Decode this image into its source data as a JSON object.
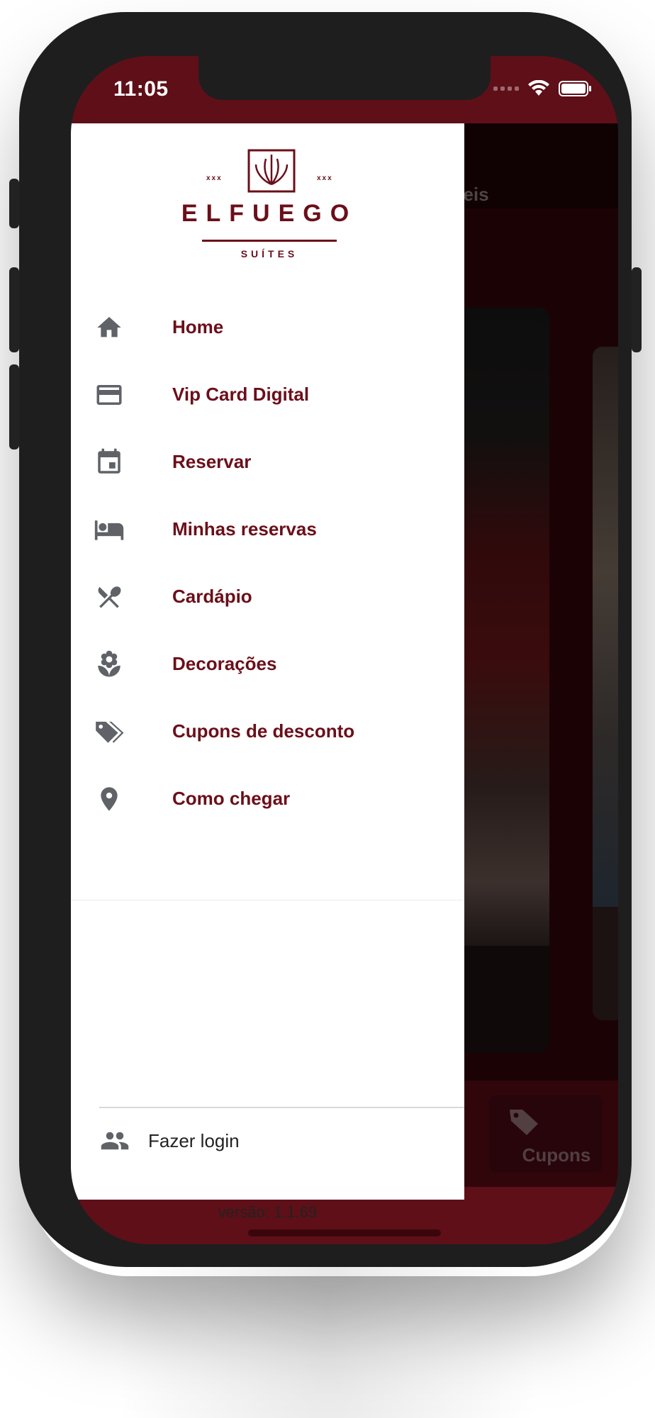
{
  "status_bar": {
    "time": "11:05",
    "icons": [
      "cellular-signal-icon",
      "wifi-icon",
      "battery-icon"
    ]
  },
  "brand": {
    "name": "ELFUEGO",
    "subtitle": "SUÍTES",
    "color": "#6b0f1a"
  },
  "background_app": {
    "section_title_partial": "oníveis",
    "tab_label": "Cupons",
    "tab_icon": "tag-icon"
  },
  "menu": {
    "items": [
      {
        "label": "Home",
        "icon": "home-icon"
      },
      {
        "label": "Vip Card Digital",
        "icon": "credit-card-icon"
      },
      {
        "label": "Reservar",
        "icon": "calendar-icon"
      },
      {
        "label": "Minhas reservas",
        "icon": "bed-icon"
      },
      {
        "label": "Cardápio",
        "icon": "utensils-icon"
      },
      {
        "label": "Decorações",
        "icon": "flower-icon"
      },
      {
        "label": "Cupons de desconto",
        "icon": "tags-icon"
      },
      {
        "label": "Como chegar",
        "icon": "location-pin-icon"
      }
    ]
  },
  "footer": {
    "login_label": "Fazer login",
    "login_icon": "people-icon",
    "version": "versão: 1.1.69"
  },
  "colors": {
    "primary": "#6b0f1a",
    "frame": "#5f0f18",
    "icon_gray": "#5f6368"
  }
}
